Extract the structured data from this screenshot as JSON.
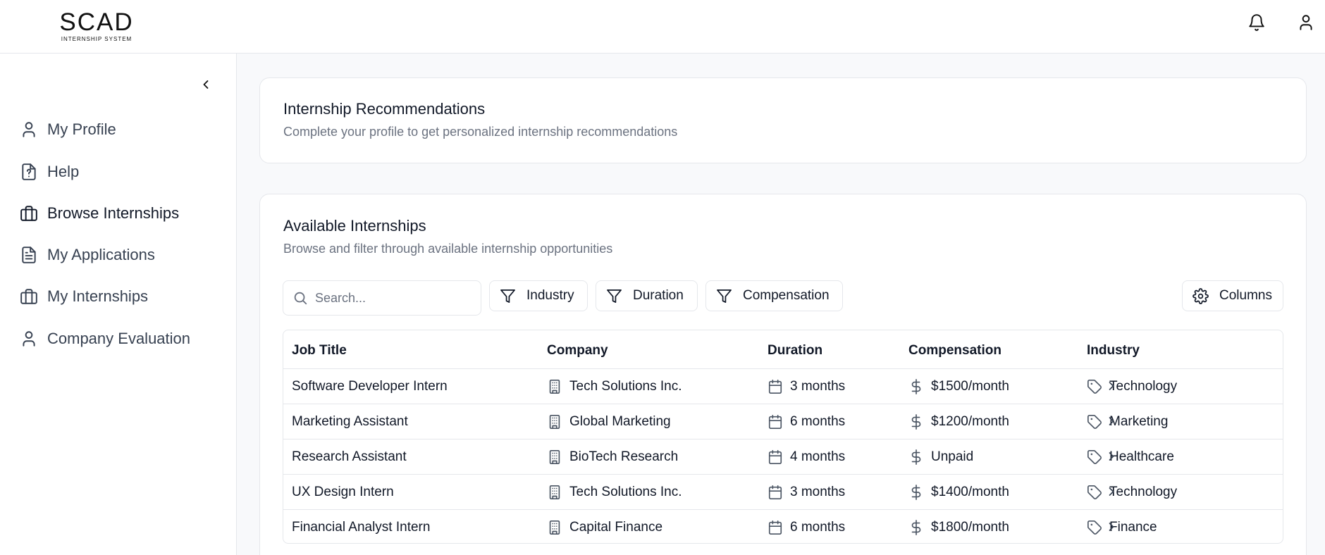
{
  "brand": {
    "name": "SCAD",
    "subtitle": "INTERNSHIP SYSTEM"
  },
  "header": {
    "icons": [
      "bell-icon",
      "user-icon"
    ]
  },
  "sidebar": {
    "items": [
      {
        "label": "My Profile",
        "icon": "user-icon"
      },
      {
        "label": "Help",
        "icon": "help-file-icon"
      },
      {
        "label": "Browse Internships",
        "icon": "briefcase-icon",
        "active": true
      },
      {
        "label": "My Applications",
        "icon": "document-icon"
      },
      {
        "label": "My Internships",
        "icon": "briefcase-icon"
      },
      {
        "label": "Company Evaluation",
        "icon": "user-icon"
      }
    ]
  },
  "recommendations": {
    "title": "Internship Recommendations",
    "description": "Complete your profile to get personalized internship recommendations"
  },
  "available": {
    "title": "Available Internships",
    "description": "Browse and filter through available internship opportunities",
    "search": {
      "placeholder": "Search...",
      "value": ""
    },
    "filters": [
      "Industry",
      "Duration",
      "Compensation"
    ],
    "columns_button": "Columns",
    "table": {
      "headers": [
        "Job Title",
        "Company",
        "Duration",
        "Compensation",
        "Industry"
      ],
      "rows": [
        {
          "title": "Software Developer Intern",
          "company": "Tech Solutions Inc.",
          "duration": "3 months",
          "compensation": "$1500/month",
          "industry": "Technology"
        },
        {
          "title": "Marketing Assistant",
          "company": "Global Marketing",
          "duration": "6 months",
          "compensation": "$1200/month",
          "industry": "Marketing"
        },
        {
          "title": "Research Assistant",
          "company": "BioTech Research",
          "duration": "4 months",
          "compensation": "Unpaid",
          "industry": "Healthcare"
        },
        {
          "title": "UX Design Intern",
          "company": "Tech Solutions Inc.",
          "duration": "3 months",
          "compensation": "$1400/month",
          "industry": "Technology"
        },
        {
          "title": "Financial Analyst Intern",
          "company": "Capital Finance",
          "duration": "6 months",
          "compensation": "$1800/month",
          "industry": "Finance"
        }
      ]
    }
  },
  "colors": {
    "background": "#f8f9fb",
    "text": "#111827",
    "muted": "#6b7280",
    "border": "#e5e7eb"
  }
}
